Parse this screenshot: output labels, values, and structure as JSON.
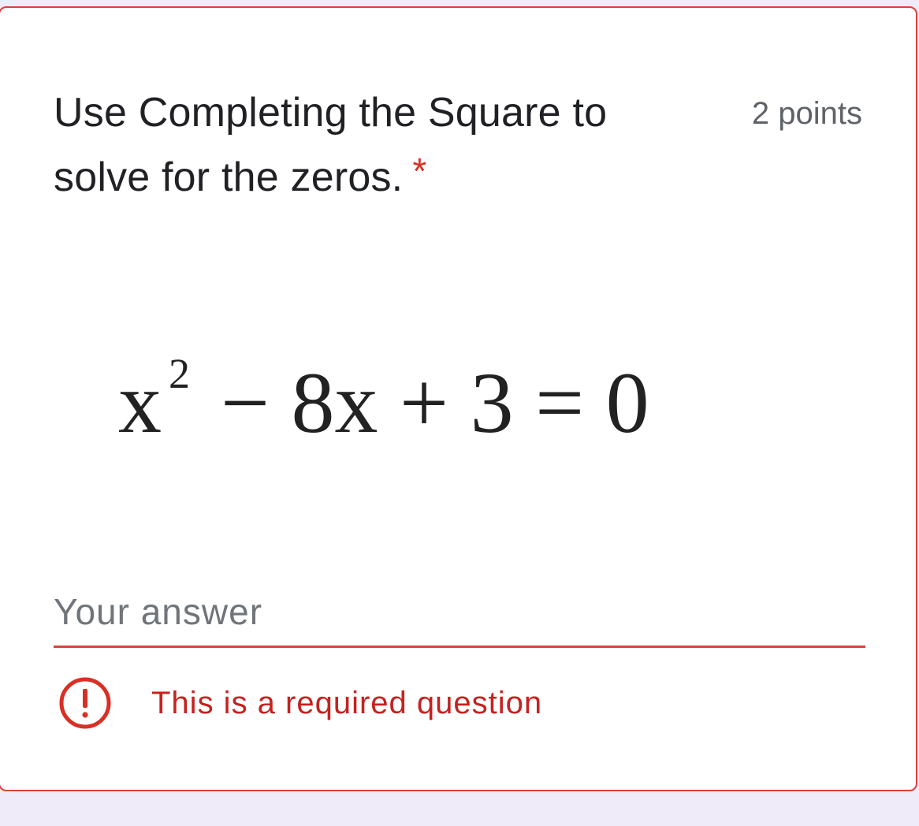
{
  "question": {
    "title": "Use Completing the Square to solve for the zeros.",
    "required_marker": "*",
    "points": "2 points"
  },
  "equation": {
    "text": "x² − 8x + 3 = 0",
    "base": "x",
    "exponent": "2",
    "rest": "− 8x + 3 = 0"
  },
  "answer": {
    "placeholder": "Your answer",
    "value": ""
  },
  "validation": {
    "message": "This is a required question",
    "icon": "error-icon"
  },
  "colors": {
    "error": "#d93025",
    "border": "#d9433a",
    "text": "#202124",
    "muted": "#5f6368",
    "background": "#f0ebf8"
  }
}
